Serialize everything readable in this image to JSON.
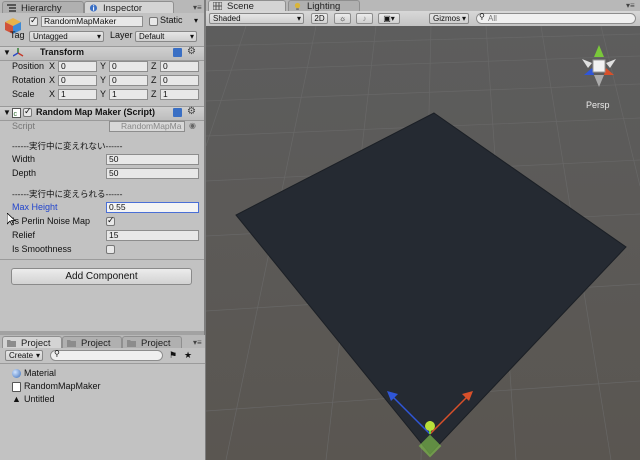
{
  "top_tabs": {
    "hierarchy": "Hierarchy",
    "inspector": "Inspector",
    "scene": "Scene",
    "lighting": "Lighting"
  },
  "object": {
    "name": "RandomMapMaker",
    "static_label": "Static",
    "tag_label": "Tag",
    "tag_value": "Untagged",
    "layer_label": "Layer",
    "layer_value": "Default"
  },
  "transform": {
    "title": "Transform",
    "position": {
      "label": "Position",
      "x": "0",
      "y": "0",
      "z": "0"
    },
    "rotation": {
      "label": "Rotation",
      "x": "0",
      "y": "0",
      "z": "0"
    },
    "scale": {
      "label": "Scale",
      "x": "1",
      "y": "1",
      "z": "1"
    },
    "axis": {
      "x": "X",
      "y": "Y",
      "z": "Z"
    }
  },
  "script_component": {
    "title": "Random Map Maker (Script)",
    "script_label": "Script",
    "script_value": "RandomMapMa",
    "header1": "------実行中に変えれない------",
    "width_label": "Width",
    "width_value": "50",
    "depth_label": "Depth",
    "depth_value": "50",
    "header2": "------実行中に変えられる------",
    "max_height_label": "Max Height",
    "max_height_value": "0.55",
    "perlin_label": "Is Perlin Noise Map",
    "relief_label": "Relief",
    "relief_value": "15",
    "smooth_label": "Is Smoothness"
  },
  "add_component_label": "Add Component",
  "project_panel": {
    "tabs": [
      "Project",
      "Project",
      "Project"
    ],
    "create_label": "Create",
    "items": [
      "Material",
      "RandomMapMaker",
      "Untitled"
    ]
  },
  "scene_toolbar": {
    "shading": "Shaded",
    "mode_2d": "2D",
    "gizmos": "Gizmos",
    "search_placeholder": "All"
  },
  "gizmo": {
    "label": "Persp"
  },
  "colors": {
    "plane": "#222831",
    "grid_bg": "#565656",
    "accent_blue": "#2244cc"
  }
}
